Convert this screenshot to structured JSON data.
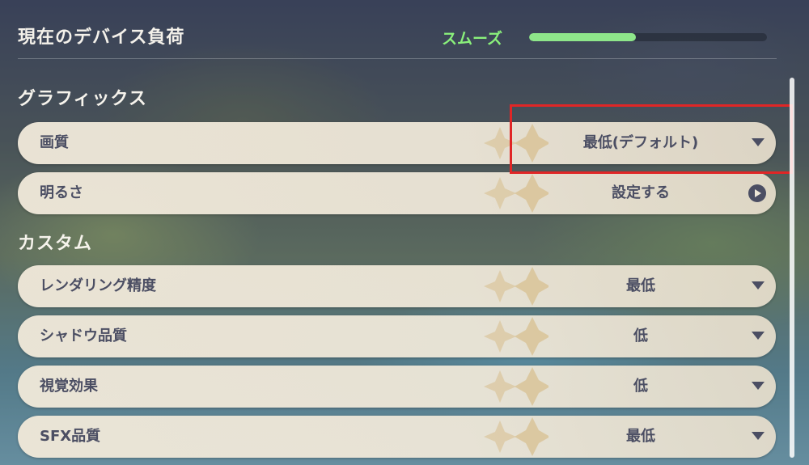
{
  "header": {
    "title": "現在のデバイス負荷",
    "status": "スムーズ",
    "load_fraction": 0.45,
    "status_color": "#8af07b"
  },
  "sections": {
    "graphics": {
      "title": "グラフィックス",
      "rows": [
        {
          "label": "画質",
          "value": "最低(デフォルト)",
          "control": "dropdown"
        },
        {
          "label": "明るさ",
          "value": "設定する",
          "control": "open-arrow"
        }
      ]
    },
    "custom": {
      "title": "カスタム",
      "rows": [
        {
          "label": "レンダリング精度",
          "value": "最低",
          "control": "dropdown"
        },
        {
          "label": "シャドウ品質",
          "value": "低",
          "control": "dropdown"
        },
        {
          "label": "視覚効果",
          "value": "低",
          "control": "dropdown"
        },
        {
          "label": "SFX品質",
          "value": "最低",
          "control": "dropdown"
        }
      ]
    }
  },
  "colors": {
    "row_bg": "#eee7d8",
    "row_text": "#4b4e63",
    "highlight": "#e02626",
    "accent": "#8ee68a"
  }
}
